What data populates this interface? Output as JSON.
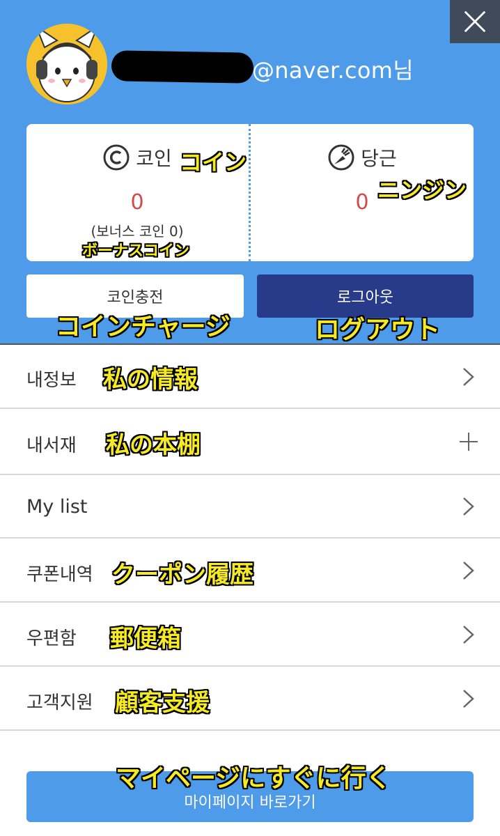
{
  "header": {
    "email_suffix": "@naver.com님",
    "close_icon": "close-icon"
  },
  "balance": {
    "coin": {
      "title": "코인",
      "title_jp": "コイン",
      "value": "0",
      "bonus": "(보너스 코인 0)",
      "bonus_jp": "ボーナスコイン",
      "icon": "coin-icon"
    },
    "carrot": {
      "title": "당근",
      "title_jp": "ニンジン",
      "value": "0",
      "icon": "carrot-icon"
    }
  },
  "buttons": {
    "charge": "코인충전",
    "charge_jp": "コインチャージ",
    "logout": "로그아웃",
    "logout_jp": "ログアウト"
  },
  "menu": [
    {
      "label": "내정보",
      "jp": "私の情報",
      "icon": "chevron-right-icon"
    },
    {
      "label": "내서재",
      "jp": "私の本棚",
      "icon": "plus-icon"
    },
    {
      "label": "My list",
      "jp": "",
      "icon": "chevron-right-icon"
    },
    {
      "label": "쿠폰내역",
      "jp": "クーポン履歴",
      "icon": "chevron-right-icon"
    },
    {
      "label": "우편함",
      "jp": "郵便箱",
      "icon": "chevron-right-icon"
    },
    {
      "label": "고객지원",
      "jp": "顧客支援",
      "icon": "chevron-right-icon"
    }
  ],
  "mypage": {
    "label": "마이페이지 바로가기",
    "jp": "マイページにすぐに行く"
  },
  "colors": {
    "header_bg": "#4d9be9",
    "logout_bg": "#283a8a",
    "value_red": "#d24a4a",
    "annotation_yellow": "#f6ea22"
  }
}
